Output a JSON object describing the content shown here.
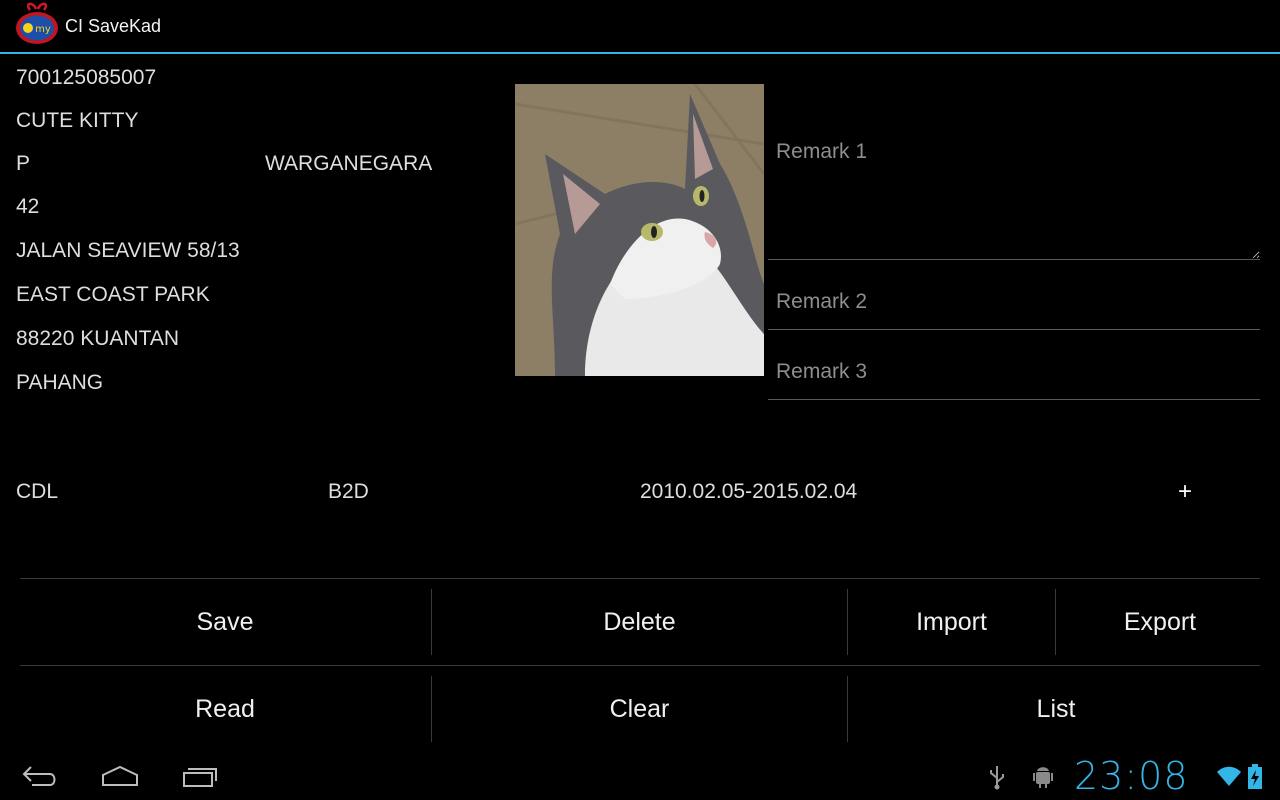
{
  "app": {
    "title": "CI SaveKad",
    "logo_text": "my"
  },
  "card": {
    "id_number": "700125085007",
    "name": "CUTE KITTY",
    "gender": "P",
    "nationality": "WARGANEGARA",
    "address_line1": "42",
    "address_line2": "JALAN SEAVIEW 58/13",
    "address_line3": "EAST COAST PARK",
    "address_line4": "88220  KUANTAN",
    "address_line5": "PAHANG"
  },
  "remarks": {
    "remark1_placeholder": "Remark 1",
    "remark2_placeholder": "Remark 2",
    "remark3_placeholder": "Remark 3"
  },
  "license": {
    "class": "CDL",
    "code": "B2D",
    "validity": "2010.02.05-2015.02.04",
    "add_label": "+"
  },
  "buttons": {
    "save": "Save",
    "delete": "Delete",
    "import": "Import",
    "export": "Export",
    "read": "Read",
    "clear": "Clear",
    "list": "List"
  },
  "status": {
    "time": "23:08"
  },
  "colors": {
    "accent": "#33b5e5",
    "background": "#000000"
  },
  "icons": {
    "nav": [
      "back-icon",
      "home-icon",
      "recent-apps-icon"
    ],
    "status": [
      "usb-icon",
      "android-debug-icon",
      "wifi-icon",
      "battery-charging-icon"
    ]
  }
}
